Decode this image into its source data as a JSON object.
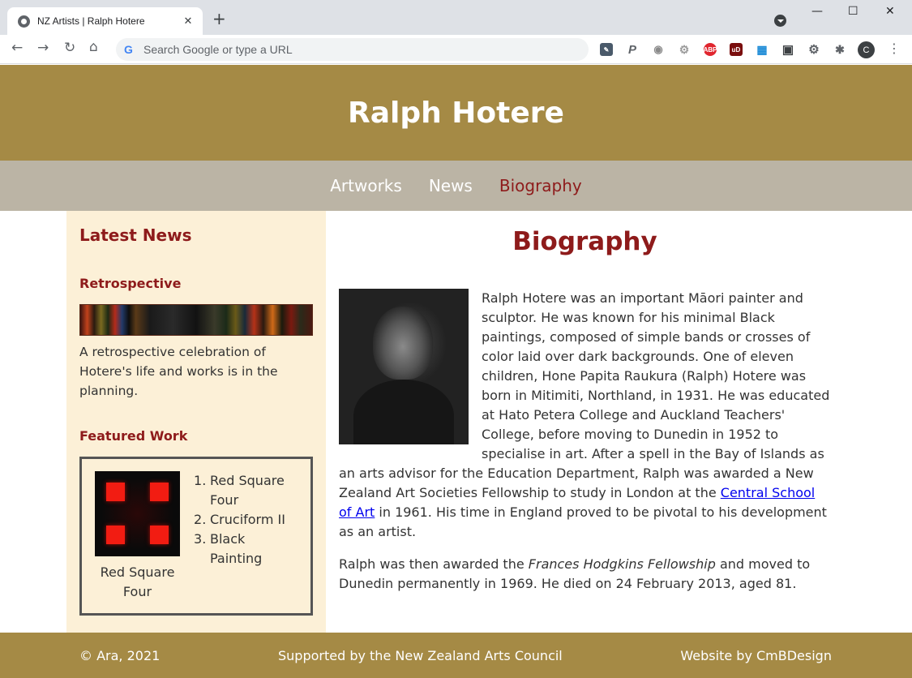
{
  "browser": {
    "tab_title": "NZ Artists | Ralph Hotere",
    "tab_close": "✕",
    "new_tab": "+",
    "omnibox_placeholder": "Search Google or type a URL",
    "google_icon": "G",
    "avatar_letter": "C",
    "extensions": [
      "P",
      "ABP",
      "uD"
    ]
  },
  "site": {
    "title": "Ralph Hotere",
    "nav": [
      "Artworks",
      "News",
      "Biography"
    ],
    "active_nav": "Biography",
    "colors": {
      "header": "#a58a45",
      "nav": "#bbb4a5",
      "accent": "#8e1b1b",
      "sidebar": "#fcf0d7"
    }
  },
  "sidebar": {
    "heading": "Latest News",
    "news_title": "Retrospective",
    "news_text": "A retrospective celebration of Hotere's life and works is in the planning.",
    "featured_heading": "Featured Work",
    "featured_caption": "Red Square Four",
    "featured_list": [
      "Red Square Four",
      "Cruciform II",
      "Black Painting"
    ]
  },
  "main": {
    "heading": "Biography",
    "p1_before_link": "Ralph Hotere was an important Māori painter and sculptor. He was known for his minimal Black paintings, composed of simple bands or crosses of color laid over dark backgrounds. One of eleven children, Hone Papita Raukura (Ralph) Hotere was born in Mitimiti, Northland, in 1931. He was educated at Hato Petera College and Auckland Teachers' College, before moving to Dunedin in 1952 to specialise in art. After a spell in the Bay of Islands as an arts advisor for the Education Department, Ralph was awarded a New Zealand Art Societies Fellowship to study in London at the ",
    "p1_link": "Central School of Art",
    "p1_after_link": " in 1961. His time in England proved to be pivotal to his development as an artist.",
    "p2_before_em": "Ralph was then awarded the ",
    "p2_em": "Frances Hodgkins Fellowship",
    "p2_after_em": " and moved to Dunedin permanently in 1969. He died on 24 February 2013, aged 81."
  },
  "footer": {
    "copyright": "© Ara, 2021",
    "supported": "Supported by the New Zealand Arts Council",
    "credit": "Website by CmBDesign"
  }
}
